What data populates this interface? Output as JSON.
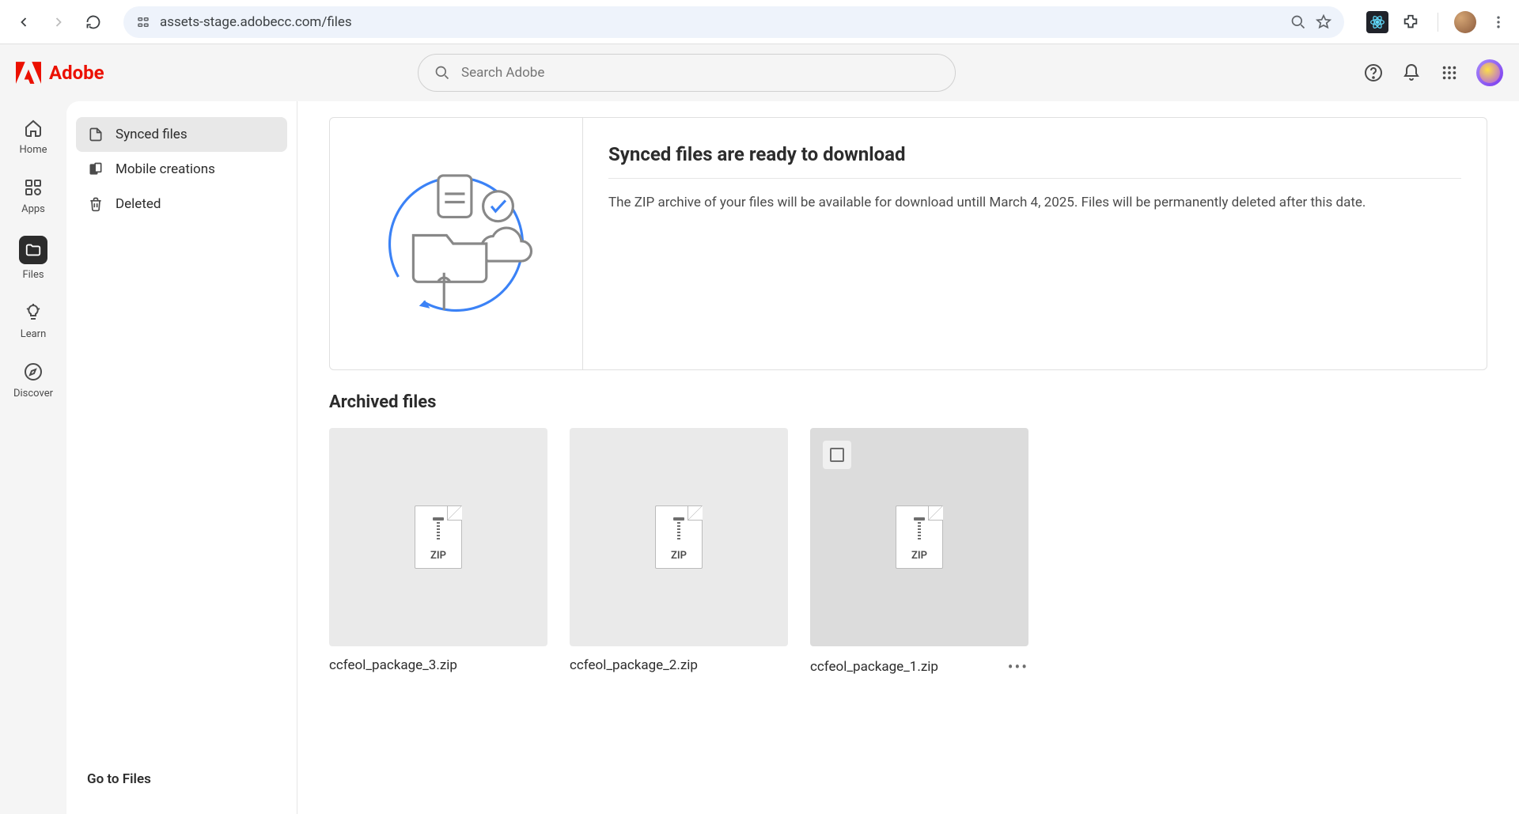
{
  "browser": {
    "url": "assets-stage.adobecc.com/files"
  },
  "brand": {
    "name": "Adobe"
  },
  "search": {
    "placeholder": "Search Adobe"
  },
  "left_rail": [
    {
      "label": "Home"
    },
    {
      "label": "Apps"
    },
    {
      "label": "Files"
    },
    {
      "label": "Learn"
    },
    {
      "label": "Discover"
    }
  ],
  "sidebar": {
    "items": [
      {
        "label": "Synced files"
      },
      {
        "label": "Mobile creations"
      },
      {
        "label": "Deleted"
      }
    ],
    "go_to_files": "Go to Files"
  },
  "banner": {
    "title": "Synced files are ready to download",
    "description": "The ZIP archive of your files will be available for download untill March 4, 2025. Files will be permanently deleted after this date."
  },
  "archived": {
    "title": "Archived files",
    "zip_label": "ZIP",
    "files": [
      {
        "name": "ccfeol_package_3.zip"
      },
      {
        "name": "ccfeol_package_2.zip"
      },
      {
        "name": "ccfeol_package_1.zip"
      }
    ]
  }
}
